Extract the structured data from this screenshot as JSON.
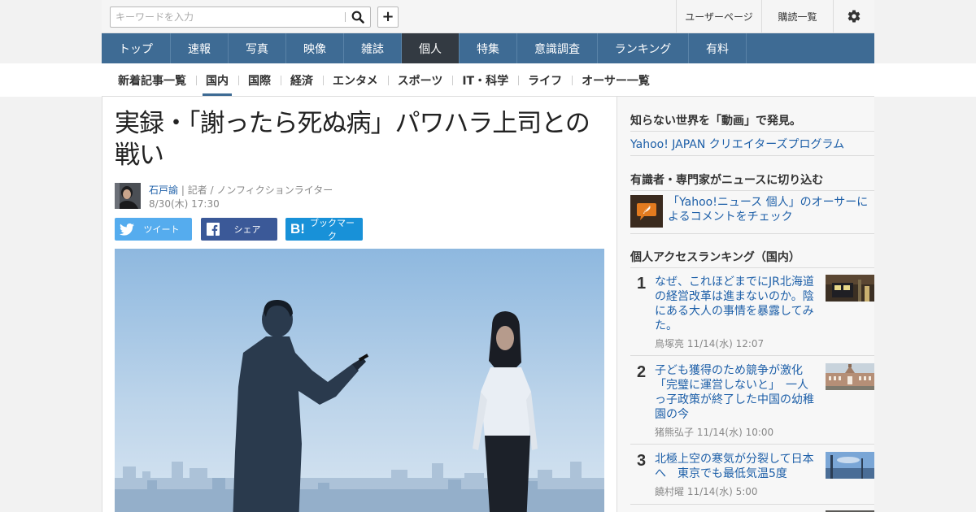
{
  "search": {
    "placeholder": "キーワードを入力"
  },
  "header": {
    "user_page": "ユーザーページ",
    "subscriptions": "購読一覧",
    "icons": {
      "search": "search-icon",
      "add": "plus-icon",
      "settings": "gear-icon"
    }
  },
  "mainnav": [
    "トップ",
    "速報",
    "写真",
    "映像",
    "雑誌",
    "個人",
    "特集",
    "意識調査",
    "ランキング",
    "有料"
  ],
  "mainnav_active": "個人",
  "subnav": [
    "新着記事一覧",
    "国内",
    "国際",
    "経済",
    "エンタメ",
    "スポーツ",
    "IT・科学",
    "ライフ",
    "オーサー一覧"
  ],
  "subnav_active": "国内",
  "article": {
    "title": "実録・「謝ったら死ぬ病」パワハラ上司との戦い",
    "author": "石戸諭",
    "author_role": "記者 / ノンフィクションライター",
    "date": "8/30(木) 17:30"
  },
  "share": {
    "tweet": "ツイート",
    "facebook": "シェア",
    "hatena": "ブックマーク"
  },
  "colors": {
    "nav": "#3e6b94",
    "nav_active": "#333a42",
    "link": "#1d5fa8",
    "twitter": "#55acee",
    "facebook": "#3b5998",
    "hatena": "#1891d8"
  },
  "sidebar": {
    "video_heading": "知らない世界を「動画」で発見。",
    "video_link": "Yahoo! JAPAN クリエイターズプログラム",
    "experts_heading": "有識者・専門家がニュースに切り込む",
    "experts_link": "「Yahoo!ニュース 個人」のオーサーによるコメントをチェック",
    "ranking_heading": "個人アクセスランキング（国内）",
    "ranking": [
      {
        "rank": "1",
        "title": "なぜ、これほどまでにJR北海道の経営改革は進まないのか。陰にある大人の事情を暴露してみた。",
        "author": "鳥塚亮",
        "date": "11/14(水) 12:07"
      },
      {
        "rank": "2",
        "title": "子ども獲得のため競争が激化「完璧に運営しないと」　一人っ子政策が終了した中国の幼稚園の今",
        "author": "猪熊弘子",
        "date": "11/14(水) 10:00"
      },
      {
        "rank": "3",
        "title": "北極上空の寒気が分裂して日本へ　東京でも最低気温5度",
        "author": "饒村曜",
        "date": "11/14(水) 5:00"
      }
    ]
  }
}
